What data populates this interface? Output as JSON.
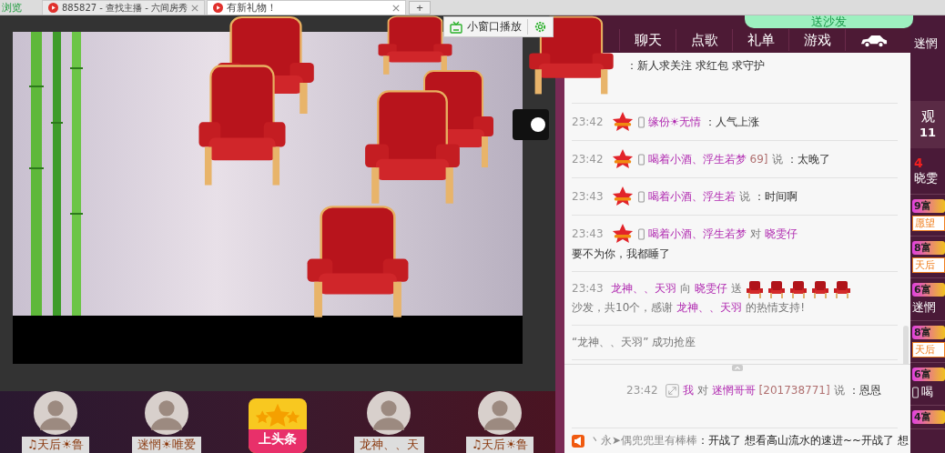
{
  "browser_tabs": [
    {
      "label": "浏览",
      "selected": false,
      "kind": "partial"
    },
    {
      "label": "885827 - 查找主播 - 六间房秀",
      "selected": false,
      "kind": "tab"
    },
    {
      "label": "有新礼物！",
      "selected": true,
      "kind": "tab"
    }
  ],
  "new_tab": "+",
  "mini_player": {
    "label": "小窗口播放"
  },
  "video": {
    "switch_on": true
  },
  "sofa_banner": {
    "label": "送沙发"
  },
  "chat_tabs": [
    {
      "label": "聊天",
      "kind": "text"
    },
    {
      "label": "点歌",
      "kind": "text"
    },
    {
      "label": "礼单",
      "kind": "text"
    },
    {
      "label": "游戏",
      "kind": "text"
    },
    {
      "kind": "car"
    }
  ],
  "messages": [
    {
      "parts": [
        {
          "kind": "plain",
          "text": "：新人求关注 求红包 求守护"
        }
      ]
    },
    {
      "parts": [
        {
          "kind": "time",
          "text": "23:42"
        },
        {
          "kind": "star"
        },
        {
          "kind": "phone"
        },
        {
          "kind": "user",
          "text": "缘份☀无情"
        },
        {
          "kind": "plain",
          "text": "：人气上涨"
        }
      ]
    },
    {
      "parts": [
        {
          "kind": "time",
          "text": "23:42"
        },
        {
          "kind": "star"
        },
        {
          "kind": "phone"
        },
        {
          "kind": "user",
          "text": "喝着小酒、浮生若梦"
        },
        {
          "kind": "id",
          "text": "69]"
        },
        {
          "kind": "muted",
          "text": "说"
        },
        {
          "kind": "plain",
          "text": "：太晚了"
        }
      ]
    },
    {
      "parts": [
        {
          "kind": "time",
          "text": "23:43"
        },
        {
          "kind": "star"
        },
        {
          "kind": "phone"
        },
        {
          "kind": "user",
          "text": "喝着小酒、浮生若"
        },
        {
          "kind": "muted",
          "text": "说"
        },
        {
          "kind": "plain",
          "text": "：时间啊"
        }
      ]
    },
    {
      "parts": [
        {
          "kind": "time",
          "text": "23:43"
        },
        {
          "kind": "star"
        },
        {
          "kind": "phone"
        },
        {
          "kind": "user",
          "text": "喝着小酒、浮生若梦"
        },
        {
          "kind": "muted",
          "text": "对"
        },
        {
          "kind": "user",
          "text": "晓雯仔"
        },
        {
          "kind": "plain",
          "text": "要不为你，我都睡了"
        }
      ]
    },
    {
      "parts": [
        {
          "kind": "time",
          "text": "23:43"
        },
        {
          "kind": "user",
          "text": "龙神、、天羽"
        },
        {
          "kind": "muted",
          "text": "向"
        },
        {
          "kind": "user",
          "text": "晓雯仔"
        },
        {
          "kind": "muted",
          "text": "送"
        },
        {
          "kind": "gift"
        },
        {
          "kind": "gift"
        },
        {
          "kind": "gift"
        },
        {
          "kind": "gift"
        },
        {
          "kind": "gift"
        },
        {
          "kind": "muted",
          "text": "沙发，共10个，感谢"
        },
        {
          "kind": "user",
          "text": "龙神、、天羽"
        },
        {
          "kind": "muted",
          "text": "的热情支持!"
        }
      ]
    },
    {
      "parts": [
        {
          "kind": "muted",
          "text": "“龙神、、天羽” 成功抢座"
        }
      ]
    }
  ],
  "private_messages": [
    {
      "parts": [
        {
          "kind": "time",
          "text": "23:42"
        },
        {
          "kind": "resize"
        },
        {
          "kind": "user",
          "text": "我"
        },
        {
          "kind": "muted",
          "text": "对"
        },
        {
          "kind": "user",
          "text": "迷惘哥哥"
        },
        {
          "kind": "id",
          "text": "[201738771]"
        },
        {
          "kind": "muted",
          "text": "说"
        },
        {
          "kind": "plain",
          "text": "：恩恩"
        }
      ]
    }
  ],
  "broadcast": {
    "sender": "丶永➤偶兜兜里有棒棒",
    "text": "：开战了 想看高山流水的速进~~开战了 想"
  },
  "side_panel": {
    "top_name": "迷惘",
    "viewers_label": "观",
    "viewers_count": "11",
    "rank": "4",
    "rank_name": "晓雯",
    "entries": [
      {
        "badge": "9富",
        "kind": "tag",
        "text": "愿望"
      },
      {
        "badge": "8富",
        "kind": "tag",
        "text": "天后"
      },
      {
        "badge": "6富",
        "kind": "name",
        "text": "迷惘"
      },
      {
        "badge": "8富",
        "kind": "tag",
        "text": "天后"
      },
      {
        "badge": "6富",
        "kind": "phone",
        "text": "喝"
      },
      {
        "badge": "4富",
        "kind": "none"
      }
    ]
  },
  "bottom_strip": [
    {
      "kind": "avatar",
      "label": "♫天后☀鲁"
    },
    {
      "kind": "avatar",
      "label": "迷惘☀唯爱"
    },
    {
      "kind": "headline",
      "label": "上头条"
    },
    {
      "kind": "avatar",
      "label": "龙神、、天"
    },
    {
      "kind": "avatar",
      "label": "♫天后☀鲁"
    }
  ]
}
